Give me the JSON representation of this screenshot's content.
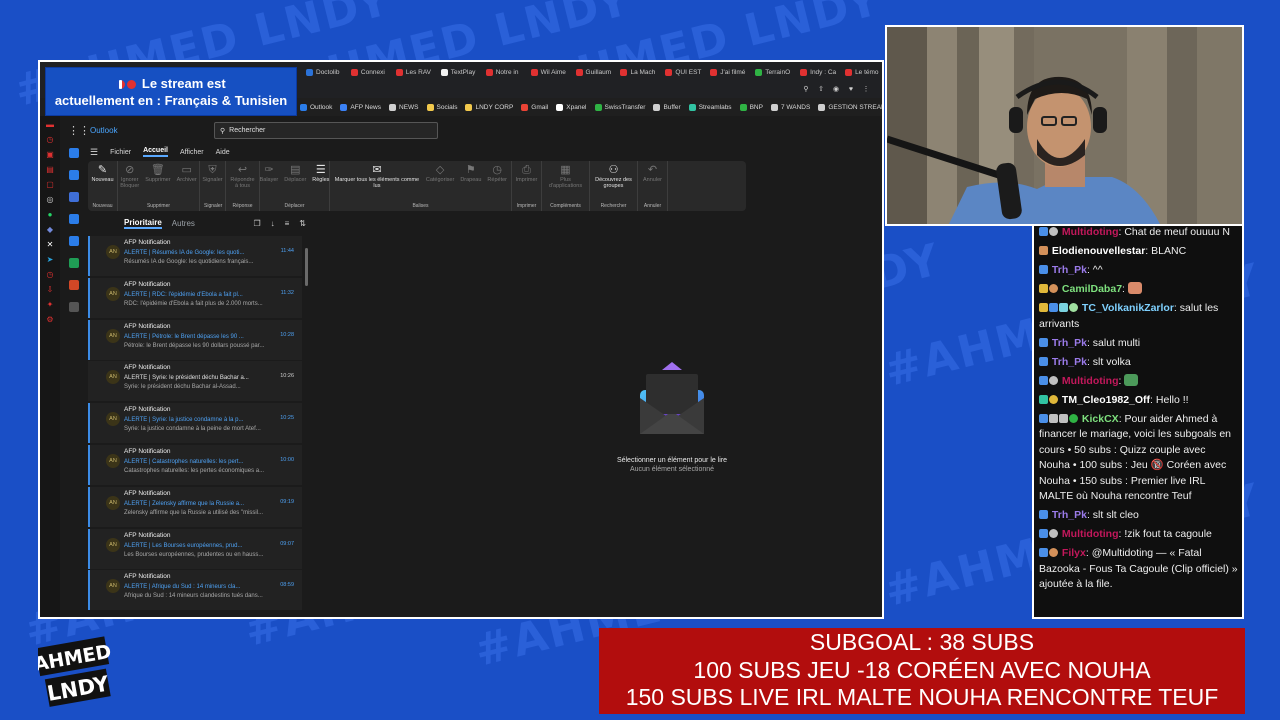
{
  "overlay": {
    "lang_banner_line1": "Le stream est",
    "lang_banner_line2": "actuellement en : Français & Tunisien",
    "subgoal": [
      "SUBGOAL : 38 SUBS",
      "100 SUBS JEU -18 CORÉEN AVEC NOUHA",
      "150 SUBS LIVE IRL MALTE NOUHA RENCONTRE TEUF"
    ],
    "logo_text_1": "AHMED",
    "logo_text_2": "LNDY",
    "watermark": "#AHMED LNDY"
  },
  "browser": {
    "tabs": [
      {
        "label": "Doctolib",
        "color": "#2b72d8"
      },
      {
        "label": "Connexi",
        "color": "#e03131"
      },
      {
        "label": "Les RAV",
        "color": "#e03131"
      },
      {
        "label": "TextPlay",
        "color": "#f2f2f2"
      },
      {
        "label": "Notre in",
        "color": "#e03131"
      },
      {
        "label": "Wil Aime",
        "color": "#e03131"
      },
      {
        "label": "Guillaum",
        "color": "#e03131"
      },
      {
        "label": "La Mach",
        "color": "#e03131"
      },
      {
        "label": "QUI EST",
        "color": "#e03131"
      },
      {
        "label": "J'ai filmé",
        "color": "#e03131"
      },
      {
        "label": "TerrainO",
        "color": "#2fb344"
      },
      {
        "label": "Indy : Ca",
        "color": "#e03131"
      },
      {
        "label": "Le témo",
        "color": "#e03131"
      }
    ],
    "bookmarks": [
      {
        "label": "Outlook",
        "color": "#2b7de9"
      },
      {
        "label": "AFP News",
        "color": "#3b82f6"
      },
      {
        "label": "NEWS",
        "color": "#cfcfcf"
      },
      {
        "label": "Socials",
        "color": "#f2c94c"
      },
      {
        "label": "LNDY CORP",
        "color": "#f2c94c"
      },
      {
        "label": "Gmail",
        "color": "#ea4335"
      },
      {
        "label": "Xpanel",
        "color": "#ffffff"
      },
      {
        "label": "SwissTransfer",
        "color": "#2fb344"
      },
      {
        "label": "Buffer",
        "color": "#cfcfcf"
      },
      {
        "label": "Streamlabs",
        "color": "#31c3a2"
      },
      {
        "label": "BNP",
        "color": "#2fb344"
      },
      {
        "label": "7 WANDS",
        "color": "#cfcfcf"
      },
      {
        "label": "GESTION STREAM",
        "color": "#cfcfcf"
      }
    ]
  },
  "outlook": {
    "brand": "Outlook",
    "search_placeholder": "Rechercher",
    "menu": [
      "Fichier",
      "Accueil",
      "Afficher",
      "Aide"
    ],
    "ribbon_groups": [
      {
        "name": "Nouveau",
        "buttons": [
          {
            "label": "Nouveau",
            "glyph": "✎",
            "on": true
          }
        ]
      },
      {
        "name": "Supprimer",
        "buttons": [
          {
            "label": "Ignorer Bloquer",
            "glyph": "⊘",
            "on": false
          },
          {
            "label": "Supprimer",
            "glyph": "🗑",
            "on": false
          },
          {
            "label": "Archiver",
            "glyph": "▭",
            "on": false
          }
        ]
      },
      {
        "name": "Signaler",
        "buttons": [
          {
            "label": "Signaler",
            "glyph": "⛨",
            "on": false
          }
        ]
      },
      {
        "name": "Réponse",
        "buttons": [
          {
            "label": "Répondre à tous",
            "glyph": "↩",
            "on": false
          }
        ]
      },
      {
        "name": "Déplacer",
        "buttons": [
          {
            "label": "Balayer",
            "glyph": "✑",
            "on": false
          },
          {
            "label": "Déplacer",
            "glyph": "▤",
            "on": false
          },
          {
            "label": "Règles",
            "glyph": "☰",
            "on": true
          }
        ]
      },
      {
        "name": "Balises",
        "buttons": [
          {
            "label": "Marquer tous les éléments comme lus",
            "glyph": "✉",
            "on": true
          },
          {
            "label": "Catégoriser",
            "glyph": "◇",
            "on": false
          },
          {
            "label": "Drapeau",
            "glyph": "⚑",
            "on": false
          },
          {
            "label": "Répéter",
            "glyph": "◷",
            "on": false
          }
        ]
      },
      {
        "name": "Imprimer",
        "buttons": [
          {
            "label": "Imprimer",
            "glyph": "⎙",
            "on": false
          }
        ]
      },
      {
        "name": "Compléments",
        "buttons": [
          {
            "label": "Plus d'applications",
            "glyph": "▦",
            "on": false
          }
        ]
      },
      {
        "name": "Rechercher",
        "buttons": [
          {
            "label": "Découvrez des groupes",
            "glyph": "⚇",
            "on": true
          }
        ]
      },
      {
        "name": "Annuler",
        "buttons": [
          {
            "label": "Annuler",
            "glyph": "↶",
            "on": false
          }
        ]
      }
    ],
    "list_tabs": {
      "focused": "Prioritaire",
      "other": "Autres"
    },
    "emails": [
      {
        "from": "AFP Notification",
        "subject": "ALERTE | Résumés IA de Google: les quoti...",
        "preview": "Résumés IA de Google: les quotidiens français...",
        "time": "11:44",
        "unread": true
      },
      {
        "from": "AFP Notification",
        "subject": "ALERTE | RDC: l'épidémie d'Ebola a fait pl...",
        "preview": "RDC: l'épidémie d'Ebola a fait plus de 2.000 morts...",
        "time": "11:32",
        "unread": true
      },
      {
        "from": "AFP Notification",
        "subject": "ALERTE | Pétrole: le Brent dépasse les 90 ...",
        "preview": "Pétrole: le Brent dépasse les 90 dollars poussé par...",
        "time": "10:28",
        "unread": true
      },
      {
        "from": "AFP Notification",
        "subject": "ALERTE | Syrie: le président déchu Bachar a...",
        "preview": "Syrie: le président déchu Bachar al-Assad...",
        "time": "10:26",
        "unread": false
      },
      {
        "from": "AFP Notification",
        "subject": "ALERTE | Syrie: la justice condamne à la p...",
        "preview": "Syrie: la justice condamne à la peine de mort Atef...",
        "time": "10:25",
        "unread": true
      },
      {
        "from": "AFP Notification",
        "subject": "ALERTE | Catastrophes naturelles: les pert...",
        "preview": "Catastrophes naturelles: les pertes économiques a...",
        "time": "10:00",
        "unread": true
      },
      {
        "from": "AFP Notification",
        "subject": "ALERTE | Zelensky affirme que la Russie a...",
        "preview": "Zelensky affirme que la Russie a utilisé des \"missil...",
        "time": "09:19",
        "unread": true
      },
      {
        "from": "AFP Notification",
        "subject": "ALERTE | Les Bourses européennes, prud...",
        "preview": "Les Bourses européennes, prudentes ou en hauss...",
        "time": "09:07",
        "unread": true
      },
      {
        "from": "AFP Notification",
        "subject": "ALERTE | Afrique du Sud : 14 mineurs cla...",
        "preview": "Afrique du Sud : 14 mineurs clandestins tués dans...",
        "time": "08:59",
        "unread": true
      }
    ],
    "avatar_initials": "AN",
    "reading_title": "Sélectionner un élément pour le lire",
    "reading_sub": "Aucun élément sélectionné"
  },
  "chat": [
    {
      "badges": [
        "#4a8fe8",
        "#c0c0c0"
      ],
      "user": "Multidoting",
      "color": "#c2185b",
      "message": "Chat de meuf ouuuu N"
    },
    {
      "badges": [
        "#d4915a"
      ],
      "user": "Elodienouvellestar",
      "color": "#ffffff",
      "message": "BLANC"
    },
    {
      "badges": [
        "#4a8fe8"
      ],
      "user": "Trh_Pk",
      "color": "#9b7bea",
      "message": "^^"
    },
    {
      "badges": [
        "#e0b83a",
        "#d4915a"
      ],
      "user": "CamilDaba7",
      "color": "#7ee07e",
      "message": "",
      "emote": "#d98a6a"
    },
    {
      "badges": [
        "#e0b83a",
        "#4a8fe8",
        "#7bd3e0",
        "#a0e0a0"
      ],
      "user": "TC_VolkanikZarlor",
      "color": "#7fd1ff",
      "message": "salut les arrivants"
    },
    {
      "badges": [
        "#4a8fe8"
      ],
      "user": "Trh_Pk",
      "color": "#9b7bea",
      "message": "salut multi"
    },
    {
      "badges": [
        "#4a8fe8"
      ],
      "user": "Trh_Pk",
      "color": "#9b7bea",
      "message": "slt volka"
    },
    {
      "badges": [
        "#4a8fe8",
        "#c0c0c0"
      ],
      "user": "Multidoting",
      "color": "#c2185b",
      "message": "",
      "emote": "#4c9a5a"
    },
    {
      "badges": [
        "#31c3a2",
        "#e0b83a"
      ],
      "user": "TM_Cleo1982_Off",
      "color": "#ffffff",
      "message": "Hello !!"
    },
    {
      "badges": [
        "#4a8fe8",
        "#c0c0c0",
        "#c0c0c0",
        "#2fb344"
      ],
      "user": "KickCX",
      "color": "#7ee07e",
      "message": "Pour aider Ahmed à financer le mariage, voici les subgoals en cours • 50 subs : Quizz couple avec Nouha • 100 subs : Jeu 🔞 Coréen avec Nouha • 150 subs : Premier live IRL MALTE où Nouha rencontre Teuf"
    },
    {
      "badges": [
        "#4a8fe8"
      ],
      "user": "Trh_Pk",
      "color": "#9b7bea",
      "message": "slt slt cleo"
    },
    {
      "badges": [
        "#4a8fe8",
        "#c0c0c0"
      ],
      "user": "Multidoting",
      "color": "#c2185b",
      "message": "!zik fout ta cagoule"
    },
    {
      "badges": [
        "#4a8fe8",
        "#d4915a"
      ],
      "user": "Filyx",
      "color": "#c2185b",
      "message": "@Multidoting — « Fatal Bazooka - Fous Ta Cagoule (Clip officiel) » ajoutée à la file."
    }
  ]
}
